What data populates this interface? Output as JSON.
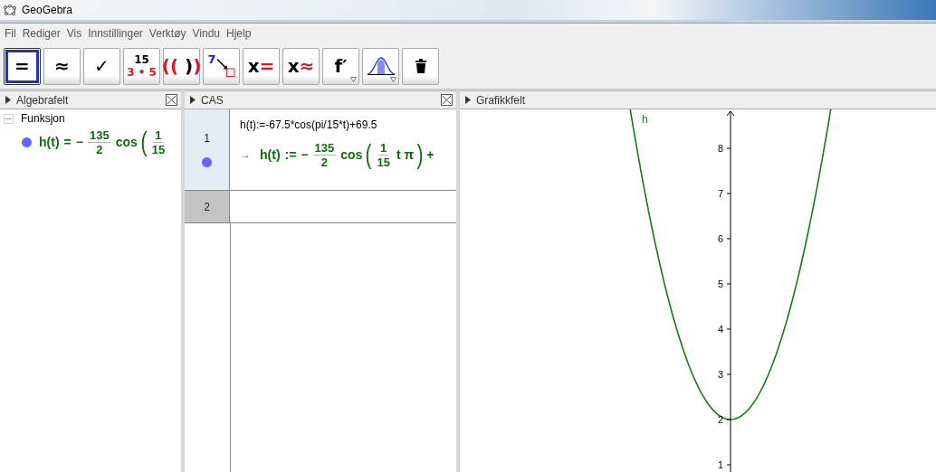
{
  "window": {
    "title": "GeoGebra"
  },
  "menu": [
    "Fil",
    "Rediger",
    "Vis",
    "Innstillinger",
    "Verktøy",
    "Vindu",
    "Hjelp"
  ],
  "toolbar": [
    {
      "kind": "glyph",
      "selected": true,
      "parts": [
        {
          "text": "=",
          "color": "#000000"
        }
      ]
    },
    {
      "kind": "glyph",
      "selected": false,
      "parts": [
        {
          "text": "≈",
          "color": "#000000"
        }
      ]
    },
    {
      "kind": "glyph",
      "selected": false,
      "parts": [
        {
          "text": "✓",
          "color": "#000000"
        }
      ]
    },
    {
      "kind": "stack",
      "selected": false,
      "parts": [
        {
          "text": "15",
          "color": "#000000"
        },
        {
          "text": "3 • 5",
          "color": "#e0141e"
        }
      ]
    },
    {
      "kind": "glyph",
      "selected": false,
      "parts": [
        {
          "text": "((",
          "color": "#e0141e"
        },
        {
          "text": " )",
          "color": "#000000"
        },
        {
          "text": ")",
          "color": "#e0141e"
        }
      ]
    },
    {
      "kind": "substitute",
      "selected": false,
      "parts": [
        {
          "text": "7",
          "color": "#1a20d0"
        }
      ]
    },
    {
      "kind": "glyph",
      "selected": false,
      "parts": [
        {
          "text": "x",
          "color": "#000000"
        },
        {
          "text": "=",
          "color": "#e0141e"
        }
      ]
    },
    {
      "kind": "glyph",
      "selected": false,
      "parts": [
        {
          "text": "x",
          "color": "#000000"
        },
        {
          "text": "≈",
          "color": "#e0141e"
        }
      ]
    },
    {
      "kind": "glyph",
      "selected": false,
      "menu": true,
      "parts": [
        {
          "text": "f′",
          "color": "#000000"
        }
      ]
    },
    {
      "kind": "distribution",
      "selected": false,
      "menu": true
    },
    {
      "kind": "trash",
      "selected": false
    }
  ],
  "algebra": {
    "title": "Algebrafelt",
    "groups": [
      {
        "label": "Funksjon",
        "expanded": true,
        "children": [
          {
            "color": "#6666ff",
            "math": [
              {
                "kind": "text",
                "text": "h(t)"
              },
              {
                "kind": "text",
                "text": "="
              },
              {
                "kind": "text",
                "text": "−"
              },
              {
                "kind": "frac",
                "num": "135",
                "den": "2"
              },
              {
                "kind": "text",
                "text": "cos"
              },
              {
                "kind": "paren",
                "text": "("
              },
              {
                "kind": "frac",
                "num": "1",
                "den": "15"
              }
            ]
          }
        ]
      }
    ]
  },
  "cas": {
    "title": "CAS",
    "rows": [
      {
        "number": "1",
        "selected": false,
        "input": "h(t):=-67.5*cos(pi/15*t)+69.5",
        "color": "#6666ff",
        "arrow": "→",
        "math": [
          {
            "kind": "text",
            "text": "h(t)"
          },
          {
            "kind": "text",
            "text": ":="
          },
          {
            "kind": "text",
            "text": "−"
          },
          {
            "kind": "frac",
            "num": "135",
            "den": "2"
          },
          {
            "kind": "text",
            "text": "cos"
          },
          {
            "kind": "paren",
            "text": "("
          },
          {
            "kind": "frac",
            "num": "1",
            "den": "15"
          },
          {
            "kind": "text",
            "text": "t π"
          },
          {
            "kind": "paren",
            "text": ")"
          },
          {
            "kind": "text",
            "text": "+"
          }
        ]
      },
      {
        "number": "2",
        "selected": true
      }
    ]
  },
  "graphics": {
    "title": "Grafikkfelt",
    "function_label": "h",
    "y_ticks": [
      "8",
      "7",
      "6",
      "5",
      "4",
      "3",
      "2",
      "1"
    ]
  }
}
